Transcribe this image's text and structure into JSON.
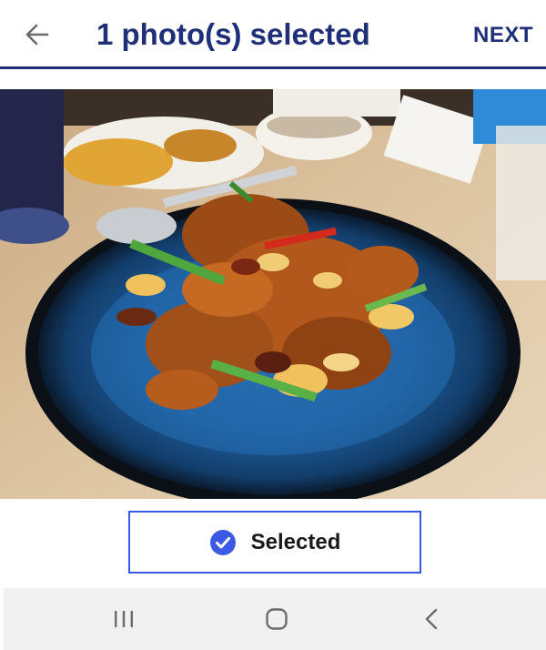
{
  "header": {
    "title": "1 photo(s) selected",
    "next_label": "NEXT",
    "back_icon": "arrow-left-icon",
    "accent_color": "#1f2f7a"
  },
  "photo": {
    "description_icon": "food-photo",
    "selected": true
  },
  "selection": {
    "label": "Selected",
    "icon": "check-circle-icon",
    "color": "#3b59e6"
  },
  "system_nav": {
    "recents_icon": "recents-icon",
    "home_icon": "home-icon",
    "back_icon": "back-chevron-icon"
  }
}
